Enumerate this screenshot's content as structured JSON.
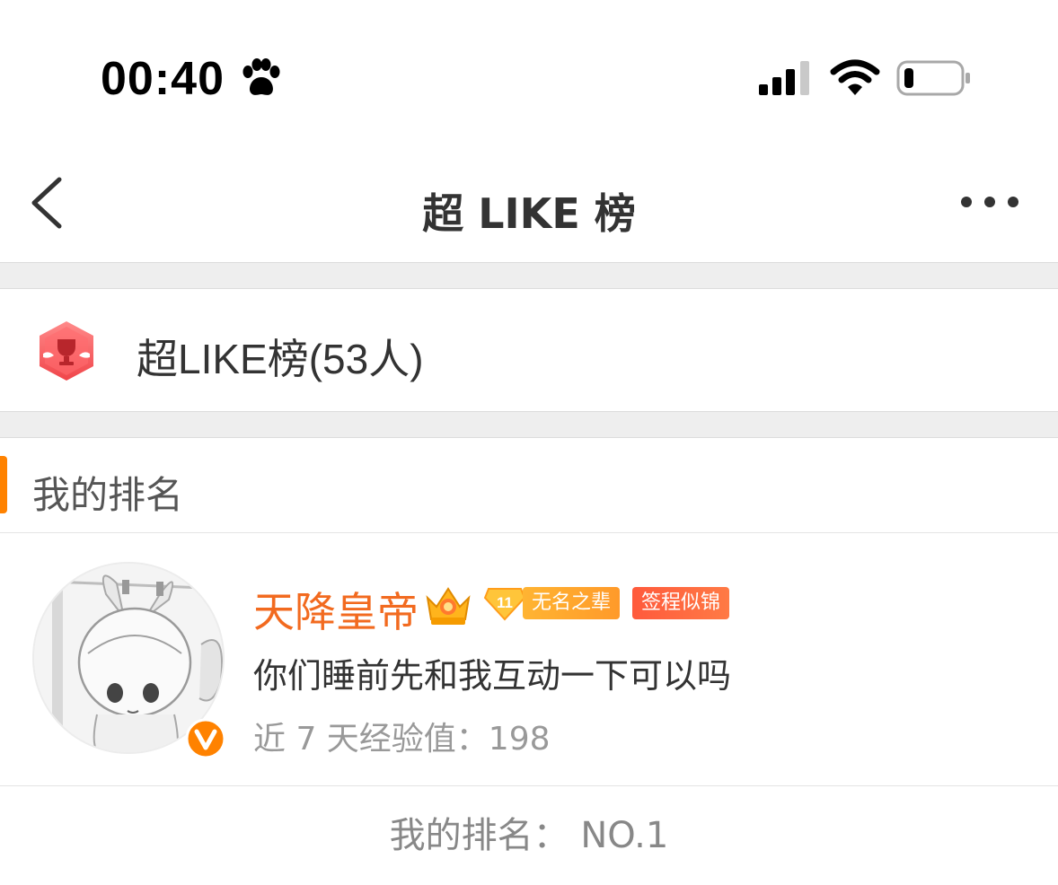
{
  "status_bar": {
    "time": "00:40",
    "icons": [
      "paw-icon",
      "signal-icon",
      "wifi-icon",
      "battery-icon"
    ]
  },
  "nav": {
    "title": "超 LIKE 榜",
    "back_icon": "chevron-left-icon",
    "more_icon": "more-dots-icon"
  },
  "board": {
    "label": "超LIKE榜(53人)",
    "icon": "trophy-icon"
  },
  "section": {
    "title": "我的排名"
  },
  "user": {
    "name": "天降皇帝",
    "level": "11",
    "level_title": "无名之辈",
    "medal": "签程似锦",
    "bio": "你们睡前先和我互动一下可以吗",
    "exp_label": "近 7 天经验值：",
    "exp_value": "198",
    "verified": true
  },
  "my_rank": {
    "text": "我的排名：  NO.1"
  },
  "colors": {
    "accent": "#ff8200",
    "username": "#f26a1f",
    "gap_bg": "#eeeeee"
  }
}
